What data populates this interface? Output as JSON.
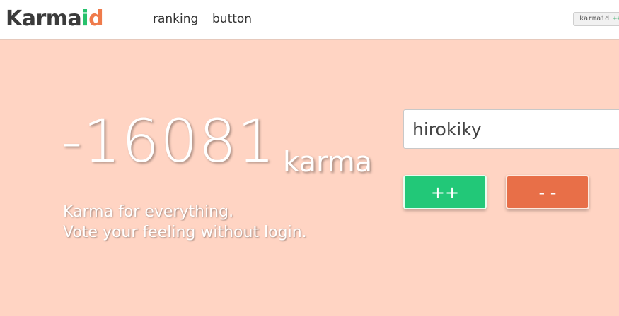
{
  "header": {
    "logo": {
      "part1": "Karma",
      "part2": "i",
      "part3": "d"
    },
    "nav": [
      {
        "label": "ranking"
      },
      {
        "label": "button"
      }
    ],
    "badge": {
      "text": "karmaid",
      "suffix": "++"
    }
  },
  "hero": {
    "karma_value": "-16081",
    "karma_unit": "karma",
    "tagline_line1": "Karma for everything.",
    "tagline_line2": "Vote your feeling without login."
  },
  "vote": {
    "input_value": "hirokiky",
    "plus_label": "++",
    "minus_label": "- -"
  },
  "colors": {
    "background": "#ffd4c3",
    "plus_button": "#22c878",
    "minus_button": "#e86f48",
    "logo_green": "#27c26c",
    "logo_orange": "#ef7b4b"
  }
}
